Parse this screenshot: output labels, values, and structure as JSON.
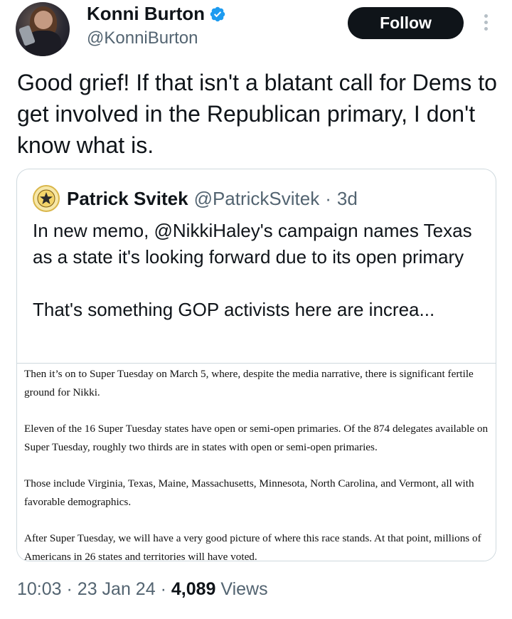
{
  "author": {
    "display_name": "Konni Burton",
    "handle": "@KonniBurton",
    "verified": true
  },
  "follow_label": "Follow",
  "tweet_text": "Good grief! If that isn't a blatant call for Dems to get involved in the Republican primary, I don't know what is.",
  "quoted": {
    "display_name": "Patrick Svitek",
    "handle": "@PatrickSvitek",
    "separator": "·",
    "age": "3d",
    "text": "In new memo, @NikkiHaley's campaign names Texas as a state it's looking forward due to its open primary\n\nThat's something GOP activists here are increa...",
    "memo_paragraphs": [
      "Then it’s on to Super Tuesday on March 5, where, despite the media narrative, there is significant fertile ground for Nikki.",
      "Eleven of the 16 Super Tuesday states have open or semi-open primaries. Of the 874 delegates available on Super Tuesday, roughly two thirds are in states with open or semi-open primaries.",
      "Those include Virginia, Texas, Maine, Massachusetts, Minnesota, North Carolina, and Vermont, all with favorable demographics.",
      "After Super Tuesday, we will have a very good picture of where this race stands. At that point, millions of Americans in 26 states and territories will have voted."
    ]
  },
  "meta": {
    "time": "10:03",
    "sep1": "·",
    "date": "23 Jan 24",
    "sep2": "·",
    "views_count": "4,089",
    "views_label": "Views"
  },
  "colors": {
    "text": "#0f1419",
    "secondary": "#536471",
    "verified": "#1d9bf0",
    "button_bg": "#0f1419"
  }
}
